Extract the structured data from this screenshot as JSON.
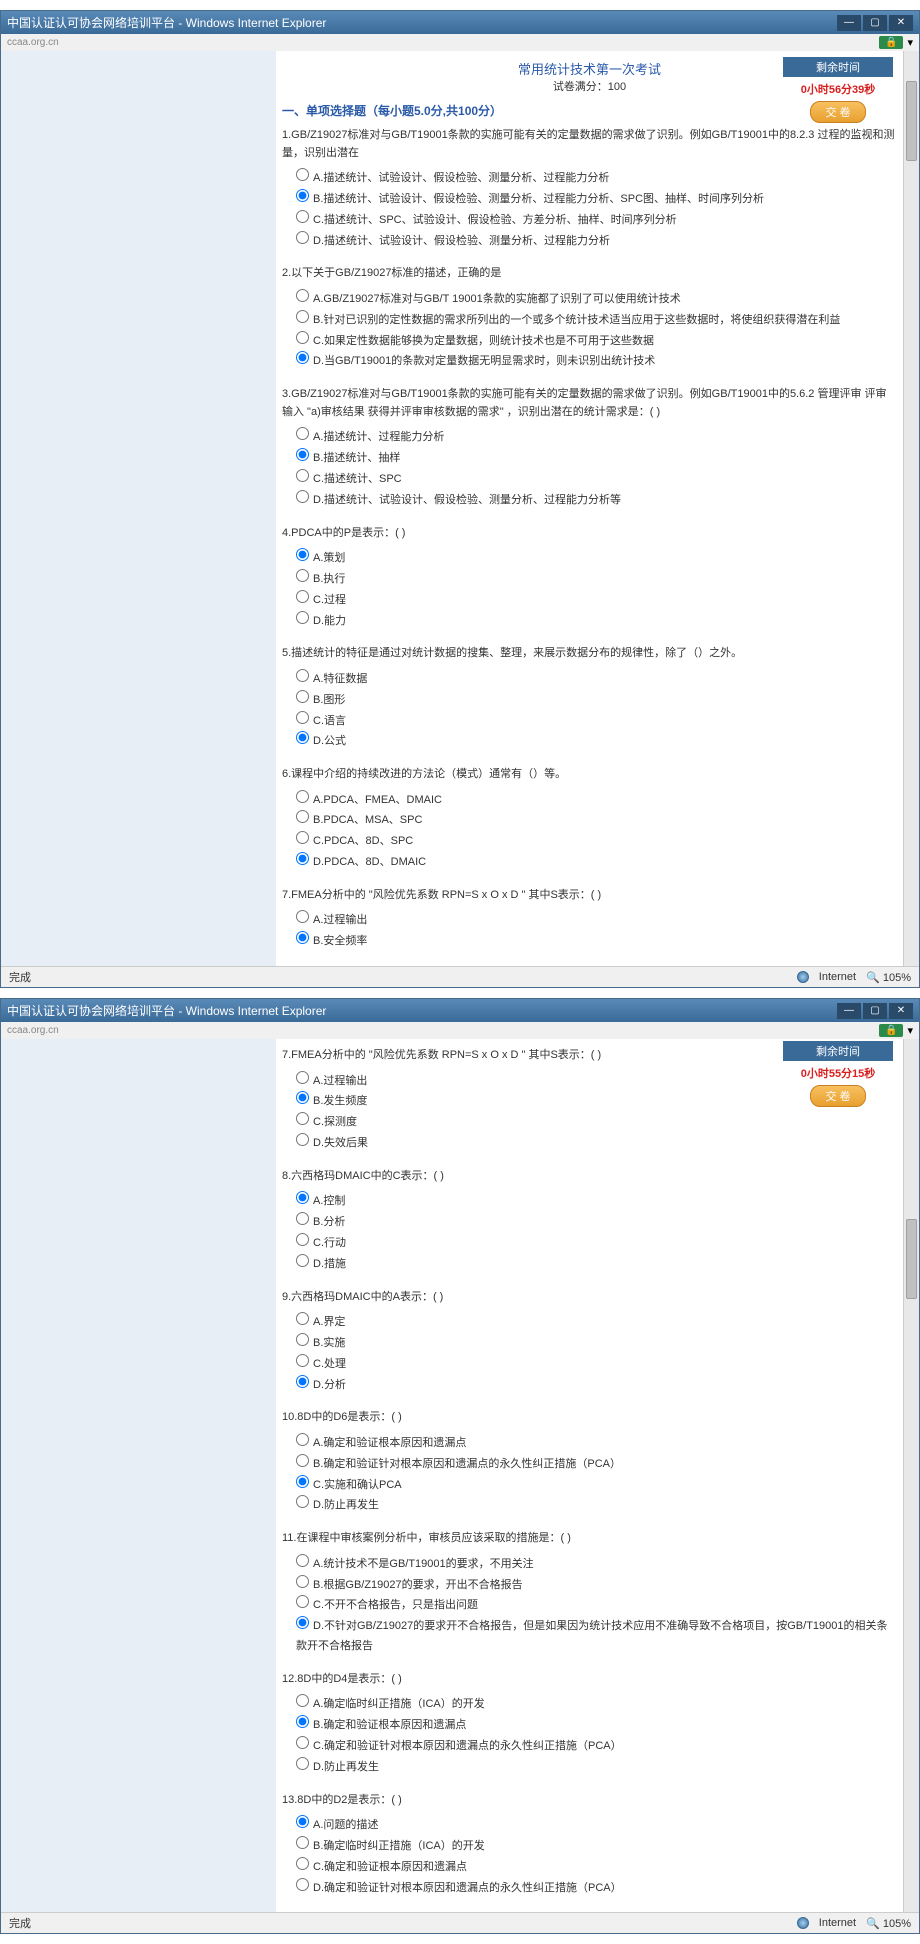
{
  "windowTitle": "中国认证认可协会网络培训平台 - Windows Internet Explorer",
  "domain": "ccaa.org.cn",
  "lockBadge": "🔒",
  "examTitle": "常用统计技术第一次考试",
  "examSub": "试卷满分：100",
  "timerLabel": "剩余时间",
  "timer1": "0小时56分39秒",
  "timer2": "0小时55分15秒",
  "submitLabel": "交 卷",
  "sectionHead": "一、单项选择题（每小题5.0分,共100分）",
  "win1": {
    "q1": {
      "text": "1.GB/Z19027标准对与GB/T19001条款的实施可能有关的定量数据的需求做了识别。例如GB/T19001中的8.2.3 过程的监视和测量，识别出潜在",
      "a": "A.描述统计、试验设计、假设检验、测量分析、过程能力分析",
      "b": "B.描述统计、试验设计、假设检验、测量分析、过程能力分析、SPC图、抽样、时间序列分析",
      "c": "C.描述统计、SPC、试验设计、假设检验、方差分析、抽样、时间序列分析",
      "d": "D.描述统计、试验设计、假设检验、测量分析、过程能力分析"
    },
    "q2": {
      "text": "2.以下关于GB/Z19027标准的描述，正确的是",
      "a": "A.GB/Z19027标准对与GB/T 19001条款的实施都了识别了可以使用统计技术",
      "b": "B.针对已识别的定性数据的需求所列出的一个或多个统计技术适当应用于这些数据时，将使组织获得潜在利益",
      "c": "C.如果定性数据能够换为定量数据，则统计技术也是不可用于这些数据",
      "d": "D.当GB/T19001的条款对定量数据无明显需求时，则未识别出统计技术"
    },
    "q3": {
      "text": "3.GB/Z19027标准对与GB/T19001条款的实施可能有关的定量数据的需求做了识别。例如GB/T19001中的5.6.2 管理评审 评审输入 \"a)审核结果 获得并评审审核数据的需求\" ，识别出潜在的统计需求是：( )",
      "a": "A.描述统计、过程能力分析",
      "b": "B.描述统计、抽样",
      "c": "C.描述统计、SPC",
      "d": "D.描述统计、试验设计、假设检验、测量分析、过程能力分析等"
    },
    "q4": {
      "text": "4.PDCA中的P是表示：( )",
      "a": "A.策划",
      "b": "B.执行",
      "c": "C.过程",
      "d": "D.能力"
    },
    "q5": {
      "text": "5.描述统计的特征是通过对统计数据的搜集、整理，来展示数据分布的规律性，除了（）之外。",
      "a": "A.特征数据",
      "b": "B.图形",
      "c": "C.语言",
      "d": "D.公式"
    },
    "q6": {
      "text": "6.课程中介绍的持续改进的方法论（模式）通常有（）等。",
      "a": "A.PDCA、FMEA、DMAIC",
      "b": "B.PDCA、MSA、SPC",
      "c": "C.PDCA、8D、SPC",
      "d": "D.PDCA、8D、DMAIC"
    },
    "q7": {
      "text": "7.FMEA分析中的 \"风险优先系数 RPN=S x O x D \" 其中S表示：( )",
      "a": "A.过程输出",
      "b": "B.安全频率"
    }
  },
  "win2": {
    "q7": {
      "text": "7.FMEA分析中的 \"风险优先系数 RPN=S x O x D \" 其中S表示：( )",
      "a": "A.过程输出",
      "b": "B.发生频度",
      "c": "C.探测度",
      "d": "D.失效后果"
    },
    "q8": {
      "text": "8.六西格玛DMAIC中的C表示：( )",
      "a": "A.控制",
      "b": "B.分析",
      "c": "C.行动",
      "d": "D.措施"
    },
    "q9": {
      "text": "9.六西格玛DMAIC中的A表示：( )",
      "a": "A.界定",
      "b": "B.实施",
      "c": "C.处理",
      "d": "D.分析"
    },
    "q10": {
      "text": "10.8D中的D6是表示：( )",
      "a": "A.确定和验证根本原因和遗漏点",
      "b": "B.确定和验证针对根本原因和遗漏点的永久性纠正措施（PCA）",
      "c": "C.实施和确认PCA",
      "d": "D.防止再发生"
    },
    "q11": {
      "text": "11.在课程中审核案例分析中，审核员应该采取的措施是：( )",
      "a": "A.统计技术不是GB/T19001的要求，不用关注",
      "b": "B.根据GB/Z19027的要求，开出不合格报告",
      "c": "C.不开不合格报告，只是指出问题",
      "d": "D.不针对GB/Z19027的要求开不合格报告，但是如果因为统计技术应用不准确导致不合格项目，按GB/T19001的相关条款开不合格报告"
    },
    "q12": {
      "text": "12.8D中的D4是表示：( )",
      "a": "A.确定临时纠正措施（ICA）的开发",
      "b": "B.确定和验证根本原因和遗漏点",
      "c": "C.确定和验证针对根本原因和遗漏点的永久性纠正措施（PCA）",
      "d": "D.防止再发生"
    },
    "q13": {
      "text": "13.8D中的D2是表示：( )",
      "a": "A.问题的描述",
      "b": "B.确定临时纠正措施（ICA）的开发",
      "c": "C.确定和验证根本原因和遗漏点",
      "d": "D.确定和验证针对根本原因和遗漏点的永久性纠正措施（PCA）"
    }
  },
  "statusDone": "完成",
  "statusNet": "Internet",
  "statusZoom": "🔍 105%"
}
